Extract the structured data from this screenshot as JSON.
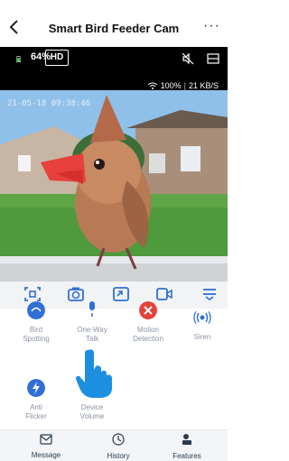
{
  "header": {
    "title": "Smart Bird Feeder Cam",
    "back_icon": "chevron-left-icon",
    "more_icon": "more-icon",
    "more_label": "···"
  },
  "camera_status": {
    "battery": "64%",
    "quality": "HD",
    "signal": "100%",
    "bitrate": "21 KB/S",
    "timestamp": "21-05-18 09:38:46"
  },
  "toolbar": {
    "items": [
      "screenshot-icon",
      "camera-icon",
      "fullscreen-icon",
      "record-icon",
      "menu-icon"
    ]
  },
  "features": {
    "items": [
      {
        "label1": "Bird",
        "label2": "Spotting",
        "icon": "bird-icon"
      },
      {
        "label1": "One-Way",
        "label2": "Talk",
        "icon": "microphone-icon"
      },
      {
        "label1": "Motion",
        "label2": "Detection",
        "icon": "motion-icon"
      },
      {
        "label1": "Siren",
        "label2": "",
        "icon": "siren-icon"
      },
      {
        "label1": "Anti",
        "label2": "Flicker",
        "icon": "flicker-icon"
      },
      {
        "label1": "Device",
        "label2": "Volume",
        "icon": "volume-icon"
      }
    ]
  },
  "bottom_nav": {
    "items": [
      {
        "label": "Message",
        "icon": "message-icon"
      },
      {
        "label": "History",
        "icon": "history-icon"
      },
      {
        "label": "Features",
        "icon": "features-icon"
      }
    ]
  },
  "colors": {
    "accent": "#2f6fd6",
    "battery": "#38c24a",
    "motion": "#e5413b"
  }
}
